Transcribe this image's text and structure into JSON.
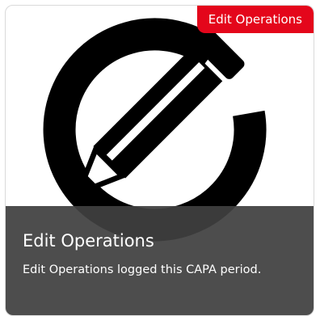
{
  "tile": {
    "badge_label": "Edit Operations",
    "title": "Edit Operations",
    "description": "Edit Operations logged this CAPA period.",
    "icon": "edit-pencil-icon",
    "colors": {
      "badge_bg": "#e4061b",
      "caption_bg": "#404040",
      "icon": "#000000"
    }
  }
}
